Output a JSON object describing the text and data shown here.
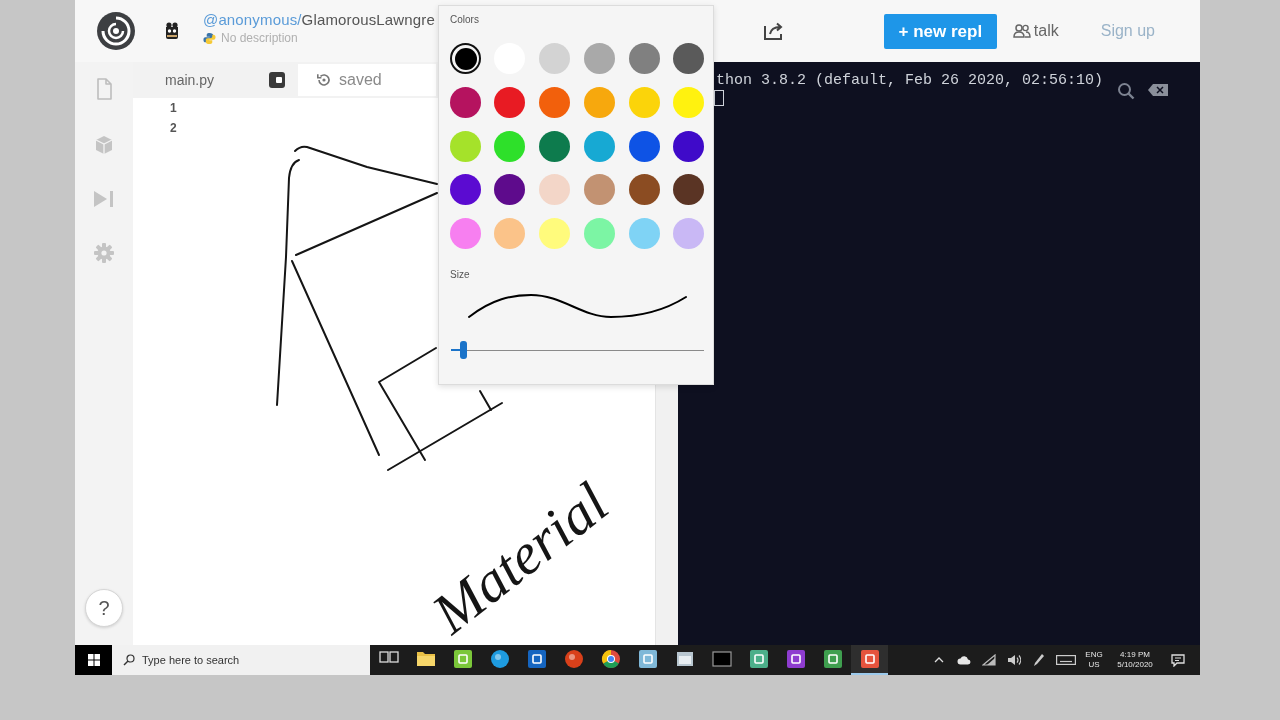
{
  "header": {
    "repl_owner": "@anonymous/",
    "repl_name": "GlamorousLawngre",
    "description": "No description",
    "new_repl_button": "+ new repl",
    "talk_link": "talk",
    "sign_up_link": "Sign up"
  },
  "sidebar": {
    "help_button": "?"
  },
  "editor": {
    "file_tab": "main.py",
    "save_status": "saved",
    "line_numbers": [
      "1",
      "2"
    ],
    "ink_word": "Material"
  },
  "console": {
    "lines": [
      "thon 3.8.2 (default, Feb 26 2020, 02:56:10)"
    ]
  },
  "color_picker": {
    "colors_label": "Colors",
    "swatches": [
      {
        "color": "#000000",
        "selected": true
      },
      {
        "color": "#ffffff",
        "selected": false
      },
      {
        "color": "#d3d3d3",
        "selected": false
      },
      {
        "color": "#a9a9a9",
        "selected": false
      },
      {
        "color": "#808080",
        "selected": false
      },
      {
        "color": "#5a5a5a",
        "selected": false
      },
      {
        "color": "#b5135f",
        "selected": false
      },
      {
        "color": "#e81b23",
        "selected": false
      },
      {
        "color": "#f2600c",
        "selected": false
      },
      {
        "color": "#f7a80d",
        "selected": false
      },
      {
        "color": "#fbd40a",
        "selected": false
      },
      {
        "color": "#fff20f",
        "selected": false
      },
      {
        "color": "#a5e22a",
        "selected": false
      },
      {
        "color": "#2ee02a",
        "selected": false
      },
      {
        "color": "#0d7b4d",
        "selected": false
      },
      {
        "color": "#17a9d3",
        "selected": false
      },
      {
        "color": "#0e53e5",
        "selected": false
      },
      {
        "color": "#3f0ac9",
        "selected": false
      },
      {
        "color": "#5b0bd1",
        "selected": false
      },
      {
        "color": "#5e0b8c",
        "selected": false
      },
      {
        "color": "#f3d6c8",
        "selected": false
      },
      {
        "color": "#c29272",
        "selected": false
      },
      {
        "color": "#8b4c22",
        "selected": false
      },
      {
        "color": "#5a3424",
        "selected": false
      },
      {
        "color": "#f77ff0",
        "selected": false
      },
      {
        "color": "#fbc389",
        "selected": false
      },
      {
        "color": "#fffb7c",
        "selected": false
      },
      {
        "color": "#7cf5a4",
        "selected": false
      },
      {
        "color": "#7fd3f5",
        "selected": false
      },
      {
        "color": "#c9b8f5",
        "selected": false
      }
    ],
    "size_label": "Size",
    "size": {
      "level": 0.05
    }
  },
  "taskbar": {
    "search_placeholder": "Type here to search",
    "apps": [
      {
        "kind": "taskview",
        "running": false
      },
      {
        "kind": "folder",
        "running": false
      },
      {
        "kind": "tile",
        "color": "#7bc73a",
        "running": false
      },
      {
        "kind": "orb",
        "color": "#1e9be0",
        "running": false
      },
      {
        "kind": "tile",
        "color": "#1565c0",
        "running": false
      },
      {
        "kind": "orb",
        "color": "#d9401a",
        "running": false
      },
      {
        "kind": "wheel",
        "running": false
      },
      {
        "kind": "tile",
        "color": "#7fb8d8",
        "running": false
      },
      {
        "kind": "window",
        "running": false
      },
      {
        "kind": "screen",
        "running": false
      },
      {
        "kind": "tile",
        "color": "#4caf8a",
        "running": false
      },
      {
        "kind": "tile",
        "color": "#8e3ccf",
        "running": false
      },
      {
        "kind": "tile",
        "color": "#3f9f4f",
        "running": false
      },
      {
        "kind": "tile",
        "color": "#e5533d",
        "running": true
      }
    ],
    "language": "ENG",
    "region": "US",
    "time": "4:19 PM",
    "date": "5/10/2020"
  }
}
